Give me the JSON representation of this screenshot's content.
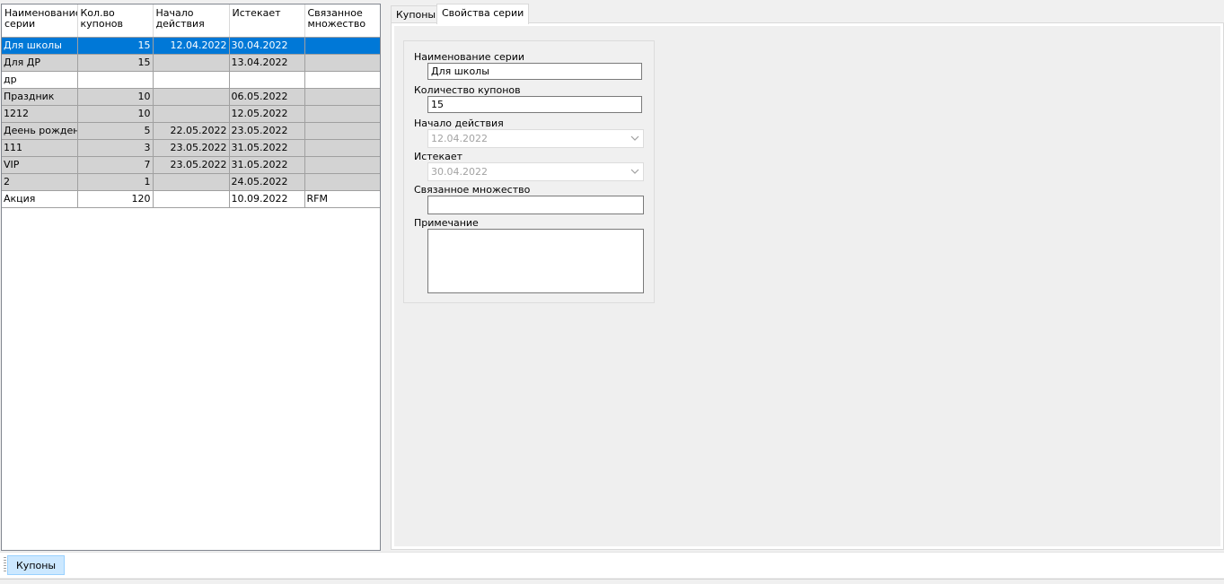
{
  "grid": {
    "columns": [
      "Наименование серии",
      "Кол.во купонов",
      "Начало действия",
      "Истекает",
      "Связанное множество"
    ],
    "rows": [
      {
        "name": "Для школы",
        "count": "15",
        "start": "12.04.2022",
        "expires": "30.04.2022",
        "set": ""
      },
      {
        "name": "Для ДР",
        "count": "15",
        "start": "",
        "expires": "13.04.2022",
        "set": ""
      },
      {
        "name": "др",
        "count": "",
        "start": "",
        "expires": "",
        "set": ""
      },
      {
        "name": "Праздник",
        "count": "10",
        "start": "",
        "expires": "06.05.2022",
        "set": ""
      },
      {
        "name": "1212",
        "count": "10",
        "start": "",
        "expires": "12.05.2022",
        "set": ""
      },
      {
        "name": "Деень рождения",
        "count": "5",
        "start": "22.05.2022",
        "expires": "23.05.2022",
        "set": ""
      },
      {
        "name": "111",
        "count": "3",
        "start": "23.05.2022",
        "expires": "31.05.2022",
        "set": ""
      },
      {
        "name": "VIP",
        "count": "7",
        "start": "23.05.2022",
        "expires": "31.05.2022",
        "set": ""
      },
      {
        "name": "2",
        "count": "1",
        "start": "",
        "expires": "24.05.2022",
        "set": ""
      },
      {
        "name": "Акция",
        "count": "120",
        "start": "",
        "expires": "10.09.2022",
        "set": "RFM"
      }
    ]
  },
  "tabs": [
    {
      "label": "Купоны"
    },
    {
      "label": "Свойства серии"
    }
  ],
  "props": {
    "name_label": "Наименование серии",
    "name_value": "Для школы",
    "count_label": "Количество купонов",
    "count_value": "15",
    "start_label": "Начало действия",
    "start_value": "12.04.2022",
    "expires_label": "Истекает",
    "expires_value": "30.04.2022",
    "set_label": "Связанное множество",
    "set_value": "",
    "note_label": "Примечание",
    "note_value": ""
  },
  "bottom": {
    "coupons_button": "Купоны"
  },
  "colors": {
    "selection": "#0078d7",
    "row_gray": "#d3d3d3",
    "button_active": "#cce8ff"
  }
}
